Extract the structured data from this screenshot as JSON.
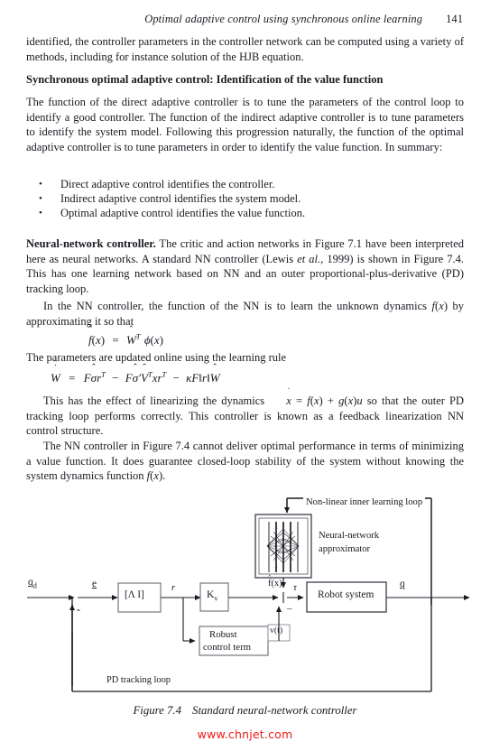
{
  "header": {
    "running_title": "Optimal adaptive control using synchronous online learning",
    "page_number": "141"
  },
  "body": {
    "para_continued": "identified, the controller parameters in the controller network can be computed using a variety of methods, including for instance solution of the HJB equation.",
    "subheading": "Synchronous optimal adaptive control: Identification of the value function",
    "para_function": "The function of the direct adaptive controller is to tune the parameters of the control loop to identify a good controller. The function of the indirect adaptive controller is to tune parameters to identify the system model. Following this progression naturally, the function of the optimal adaptive controller is to tune parameters in order to identify the value function. In summary:",
    "bullets": [
      "Direct adaptive control identifies the controller.",
      "Indirect adaptive control identifies the system model.",
      "Optimal adaptive control identifies the value function."
    ],
    "para_nn_lead": "Neural-network controller.",
    "para_nn_rest_1": " The critic and action networks in Figure 7.1 have been interpreted here as neural networks. A standard NN controller (Lewis ",
    "para_nn_italic": "et al.",
    "para_nn_rest_2": ", 1999) is shown in Figure 7.4. This has one learning network based on NN and an outer proportional-plus-derivative (PD) tracking loop.",
    "para_learn_pre": "In the NN controller, the function of the NN is to learn the unknown dynamics ",
    "para_learn_post": " by approximating it so that",
    "para_update_rule": "The parameters are updated online using the learning rule",
    "para_linearize_pre": "This has the effect of linearizing the dynamics ",
    "para_linearize_post": " so that the outer PD tracking loop performs correctly. This controller is known as a feedback linearization NN control structure.",
    "para_optimal_pre": "The NN controller in Figure 7.4 cannot deliver optimal performance in terms of minimizing a value function. It does guarantee closed-loop stability of the system without knowing the system dynamics function ",
    "para_optimal_post": "."
  },
  "math": {
    "fx_inline": "f(x)",
    "eq_approx": {
      "lhs_hat": "^",
      "lhs_base": "f",
      "lhs_arg": "(x)",
      "eq": "=",
      "w_hat": "^",
      "w_base": "W",
      "w_sup": "T",
      "phi": "ϕ",
      "phi_arg": "(x)"
    },
    "eq_update": "Ẇ = Fσ̂rᵀ − Fσ̂′V̂ᵀxrᵀ − κF‖r‖Ŵ",
    "eq_dynamics": "ẋ = f(x) + g(x)u"
  },
  "figure": {
    "caption_number": "Figure 7.4",
    "caption_text": "Standard neural-network controller",
    "labels": {
      "outer_loop": "Non-linear inner learning loop",
      "nn_approximator_line1": "Neural-network",
      "nn_approximator_line2": "approximator",
      "fhat": "f(x)",
      "fhat_accent": "^",
      "qd": "q",
      "qd_sub": "d",
      "error": "e",
      "lambda_block": "[Λ    I]",
      "r_signal": "r",
      "kv_block": "K",
      "kv_sub": "v",
      "tau": "τ",
      "robot_system": "Robot system",
      "q_out": "q",
      "robust_line1": "Robust",
      "robust_line2": "control term",
      "vt": "v(t)",
      "minus_sum_left": "-",
      "minus_sum_right": "_",
      "pd_loop": "PD tracking loop"
    }
  },
  "watermark": "www.chnjet.com"
}
